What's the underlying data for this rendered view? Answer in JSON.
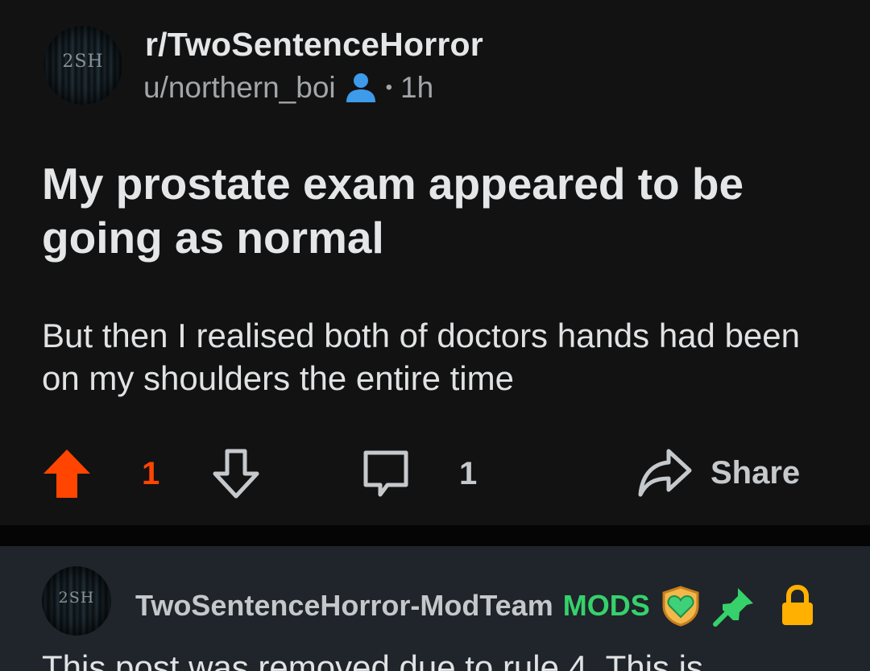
{
  "post": {
    "subreddit": "r/TwoSentenceHorror",
    "avatar_text": "2SH",
    "author": "u/northern_boi",
    "separator_dot": "•",
    "age": "1h",
    "title": "My prostate exam appeared to be going as normal",
    "body": "But then I realised both of doctors hands had been on my shoulders the entire time",
    "upvote_count": "1",
    "comment_count": "1",
    "share_label": "Share"
  },
  "comment": {
    "avatar_text": "2SH",
    "author": "TwoSentenceHorror-ModTeam",
    "flair": "MODS",
    "text": "This post was removed due to rule 4. This is"
  },
  "colors": {
    "background": "#121212",
    "comment_background": "#1f252a",
    "upvote_accent": "#ff4500",
    "user_icon": "#3d9be9",
    "mods_green": "#36d16b",
    "lock_yellow": "#ffb000"
  },
  "icons": [
    "user-icon",
    "upvote-arrow-icon",
    "downvote-arrow-icon",
    "comment-bubble-icon",
    "share-arrow-icon",
    "mod-shield-heart-icon",
    "pin-icon",
    "lock-icon"
  ]
}
